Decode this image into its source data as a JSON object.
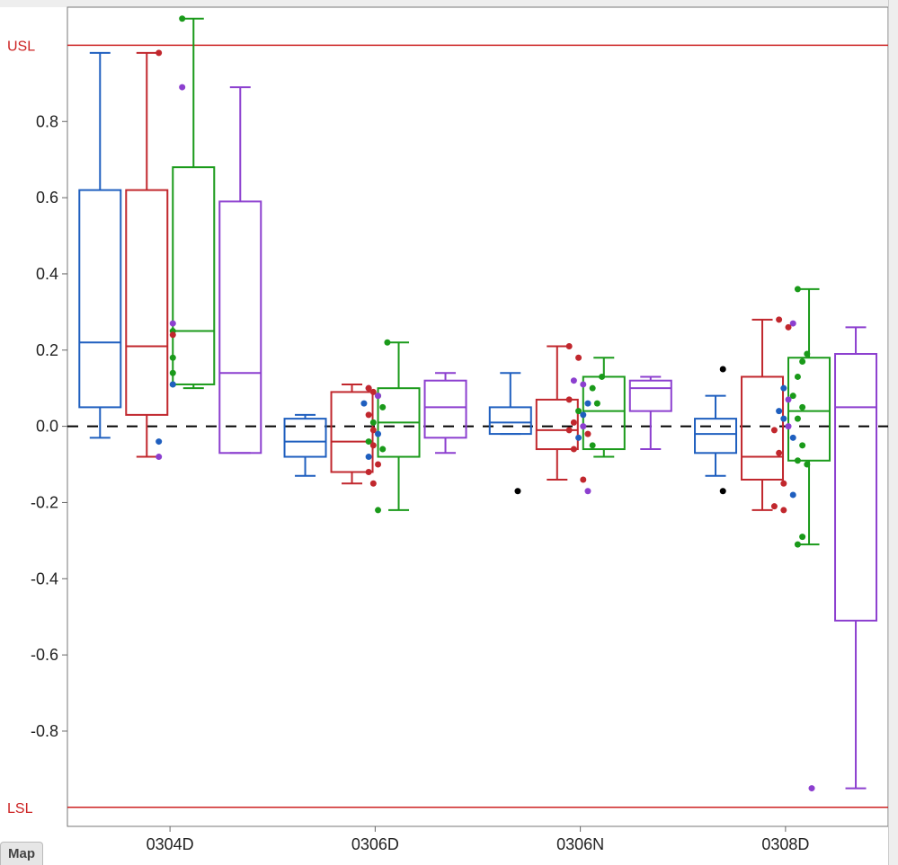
{
  "ui": {
    "mapTab": "Map"
  },
  "chart_data": {
    "type": "boxplot",
    "title": "",
    "xlabel": "",
    "ylabel": "",
    "ylim": [
      -1.05,
      1.1
    ],
    "x_categories": [
      "0304D",
      "0306D",
      "0306N",
      "0308D"
    ],
    "usl": {
      "label": "USL",
      "value": 1.0
    },
    "lsl": {
      "label": "LSL",
      "value": -1.0
    },
    "refline": 0.0,
    "grid": false,
    "series_colors": {
      "s1": "#1f5fbf",
      "s2": "#c1272d",
      "s3": "#1a9a1a",
      "s4": "#8c3fcf",
      "outlier": "#000"
    },
    "boxes": [
      {
        "cat": "0304D",
        "series": "s1",
        "min": -0.03,
        "q1": 0.05,
        "median": 0.22,
        "q3": 0.62,
        "max": 0.98
      },
      {
        "cat": "0304D",
        "series": "s2",
        "min": -0.08,
        "q1": 0.03,
        "median": 0.21,
        "q3": 0.62,
        "max": 0.98
      },
      {
        "cat": "0304D",
        "series": "s3",
        "min": 0.1,
        "q1": 0.11,
        "median": 0.25,
        "q3": 0.68,
        "max": 1.07
      },
      {
        "cat": "0304D",
        "series": "s4",
        "min": -0.07,
        "q1": -0.07,
        "median": 0.14,
        "q3": 0.59,
        "max": 0.89
      },
      {
        "cat": "0306D",
        "series": "s1",
        "min": -0.13,
        "q1": -0.08,
        "median": -0.04,
        "q3": 0.02,
        "max": 0.03
      },
      {
        "cat": "0306D",
        "series": "s2",
        "min": -0.15,
        "q1": -0.12,
        "median": -0.04,
        "q3": 0.09,
        "max": 0.11
      },
      {
        "cat": "0306D",
        "series": "s3",
        "min": -0.22,
        "q1": -0.08,
        "median": 0.01,
        "q3": 0.1,
        "max": 0.22
      },
      {
        "cat": "0306D",
        "series": "s4",
        "min": -0.07,
        "q1": -0.03,
        "median": 0.05,
        "q3": 0.12,
        "max": 0.14
      },
      {
        "cat": "0306N",
        "series": "s1",
        "min": -0.02,
        "q1": -0.02,
        "median": 0.01,
        "q3": 0.05,
        "max": 0.14
      },
      {
        "cat": "0306N",
        "series": "s2",
        "min": -0.14,
        "q1": -0.06,
        "median": -0.01,
        "q3": 0.07,
        "max": 0.21
      },
      {
        "cat": "0306N",
        "series": "s3",
        "min": -0.08,
        "q1": -0.06,
        "median": 0.04,
        "q3": 0.13,
        "max": 0.18
      },
      {
        "cat": "0306N",
        "series": "s4",
        "min": -0.06,
        "q1": 0.04,
        "median": 0.1,
        "q3": 0.12,
        "max": 0.13
      },
      {
        "cat": "0308D",
        "series": "s1",
        "min": -0.13,
        "q1": -0.07,
        "median": -0.02,
        "q3": 0.02,
        "max": 0.08
      },
      {
        "cat": "0308D",
        "series": "s2",
        "min": -0.22,
        "q1": -0.14,
        "median": -0.08,
        "q3": 0.13,
        "max": 0.28
      },
      {
        "cat": "0308D",
        "series": "s3",
        "min": -0.31,
        "q1": -0.09,
        "median": 0.04,
        "q3": 0.18,
        "max": 0.36
      },
      {
        "cat": "0308D",
        "series": "s4",
        "min": -0.95,
        "q1": -0.51,
        "median": 0.05,
        "q3": 0.19,
        "max": 0.26
      }
    ],
    "points": [
      {
        "cat": "0304D",
        "x_jitter": 1.7,
        "y": 0.98,
        "color": "s2"
      },
      {
        "cat": "0304D",
        "x_jitter": 1.7,
        "y": -0.04,
        "color": "s1"
      },
      {
        "cat": "0304D",
        "x_jitter": 1.7,
        "y": -0.08,
        "color": "s4"
      },
      {
        "cat": "0304D",
        "x_jitter": 2.2,
        "y": 1.07,
        "color": "s3"
      },
      {
        "cat": "0304D",
        "x_jitter": 2.2,
        "y": 0.89,
        "color": "s4"
      },
      {
        "cat": "0304D",
        "x_jitter": 2.0,
        "y": 0.27,
        "color": "s4"
      },
      {
        "cat": "0304D",
        "x_jitter": 2.0,
        "y": 0.25,
        "color": "s3"
      },
      {
        "cat": "0304D",
        "x_jitter": 2.0,
        "y": 0.24,
        "color": "s2"
      },
      {
        "cat": "0304D",
        "x_jitter": 2.0,
        "y": 0.18,
        "color": "s3"
      },
      {
        "cat": "0304D",
        "x_jitter": 2.0,
        "y": 0.14,
        "color": "s3"
      },
      {
        "cat": "0304D",
        "x_jitter": 2.0,
        "y": 0.11,
        "color": "s3"
      },
      {
        "cat": "0304D",
        "x_jitter": 2.0,
        "y": 0.11,
        "color": "s1"
      },
      {
        "cat": "0306D",
        "x_jitter": 1.8,
        "y": 0.1,
        "color": "s4"
      },
      {
        "cat": "0306D",
        "x_jitter": 1.8,
        "y": 0.1,
        "color": "s2"
      },
      {
        "cat": "0306D",
        "x_jitter": 1.9,
        "y": 0.09,
        "color": "s2"
      },
      {
        "cat": "0306D",
        "x_jitter": 2.0,
        "y": 0.08,
        "color": "s3"
      },
      {
        "cat": "0306D",
        "x_jitter": 2.0,
        "y": 0.08,
        "color": "s4"
      },
      {
        "cat": "0306D",
        "x_jitter": 1.7,
        "y": 0.06,
        "color": "s1"
      },
      {
        "cat": "0306D",
        "x_jitter": 2.1,
        "y": 0.05,
        "color": "s3"
      },
      {
        "cat": "0306D",
        "x_jitter": 1.8,
        "y": 0.03,
        "color": "s2"
      },
      {
        "cat": "0306D",
        "x_jitter": 2.2,
        "y": 0.22,
        "color": "s3"
      },
      {
        "cat": "0306D",
        "x_jitter": 1.9,
        "y": 0.01,
        "color": "s3"
      },
      {
        "cat": "0306D",
        "x_jitter": 1.9,
        "y": -0.01,
        "color": "s2"
      },
      {
        "cat": "0306D",
        "x_jitter": 2.0,
        "y": -0.02,
        "color": "s1"
      },
      {
        "cat": "0306D",
        "x_jitter": 1.8,
        "y": -0.04,
        "color": "s3"
      },
      {
        "cat": "0306D",
        "x_jitter": 1.9,
        "y": -0.05,
        "color": "s2"
      },
      {
        "cat": "0306D",
        "x_jitter": 2.1,
        "y": -0.06,
        "color": "s3"
      },
      {
        "cat": "0306D",
        "x_jitter": 1.8,
        "y": -0.08,
        "color": "s1"
      },
      {
        "cat": "0306D",
        "x_jitter": 2.0,
        "y": -0.1,
        "color": "s2"
      },
      {
        "cat": "0306D",
        "x_jitter": 1.8,
        "y": -0.12,
        "color": "s2"
      },
      {
        "cat": "0306D",
        "x_jitter": 1.9,
        "y": -0.15,
        "color": "s2"
      },
      {
        "cat": "0306D",
        "x_jitter": 2.0,
        "y": -0.22,
        "color": "s3"
      },
      {
        "cat": "0306N",
        "x_jitter": 0.6,
        "y": -0.17,
        "color": "outlier"
      },
      {
        "cat": "0306N",
        "x_jitter": 1.7,
        "y": 0.21,
        "color": "s2"
      },
      {
        "cat": "0306N",
        "x_jitter": 1.9,
        "y": 0.18,
        "color": "s2"
      },
      {
        "cat": "0306N",
        "x_jitter": 2.4,
        "y": 0.13,
        "color": "s3"
      },
      {
        "cat": "0306N",
        "x_jitter": 1.8,
        "y": 0.12,
        "color": "s4"
      },
      {
        "cat": "0306N",
        "x_jitter": 2.0,
        "y": 0.11,
        "color": "s4"
      },
      {
        "cat": "0306N",
        "x_jitter": 2.2,
        "y": 0.1,
        "color": "s3"
      },
      {
        "cat": "0306N",
        "x_jitter": 1.7,
        "y": 0.07,
        "color": "s2"
      },
      {
        "cat": "0306N",
        "x_jitter": 2.1,
        "y": 0.06,
        "color": "s1"
      },
      {
        "cat": "0306N",
        "x_jitter": 2.3,
        "y": 0.06,
        "color": "s3"
      },
      {
        "cat": "0306N",
        "x_jitter": 1.9,
        "y": 0.04,
        "color": "s3"
      },
      {
        "cat": "0306N",
        "x_jitter": 2.0,
        "y": 0.03,
        "color": "s1"
      },
      {
        "cat": "0306N",
        "x_jitter": 1.8,
        "y": 0.01,
        "color": "s2"
      },
      {
        "cat": "0306N",
        "x_jitter": 2.0,
        "y": 0.0,
        "color": "s4"
      },
      {
        "cat": "0306N",
        "x_jitter": 1.7,
        "y": -0.01,
        "color": "s2"
      },
      {
        "cat": "0306N",
        "x_jitter": 2.1,
        "y": -0.02,
        "color": "s2"
      },
      {
        "cat": "0306N",
        "x_jitter": 1.9,
        "y": -0.03,
        "color": "s1"
      },
      {
        "cat": "0306N",
        "x_jitter": 2.2,
        "y": -0.05,
        "color": "s3"
      },
      {
        "cat": "0306N",
        "x_jitter": 1.8,
        "y": -0.06,
        "color": "s2"
      },
      {
        "cat": "0306N",
        "x_jitter": 2.0,
        "y": -0.14,
        "color": "s2"
      },
      {
        "cat": "0306N",
        "x_jitter": 2.1,
        "y": -0.17,
        "color": "s4"
      },
      {
        "cat": "0308D",
        "x_jitter": 0.6,
        "y": 0.15,
        "color": "outlier"
      },
      {
        "cat": "0308D",
        "x_jitter": 0.6,
        "y": -0.17,
        "color": "outlier"
      },
      {
        "cat": "0308D",
        "x_jitter": 2.2,
        "y": 0.36,
        "color": "s3"
      },
      {
        "cat": "0308D",
        "x_jitter": 1.8,
        "y": 0.28,
        "color": "s2"
      },
      {
        "cat": "0308D",
        "x_jitter": 2.1,
        "y": 0.27,
        "color": "s4"
      },
      {
        "cat": "0308D",
        "x_jitter": 2.0,
        "y": 0.26,
        "color": "s2"
      },
      {
        "cat": "0308D",
        "x_jitter": 2.4,
        "y": 0.19,
        "color": "s3"
      },
      {
        "cat": "0308D",
        "x_jitter": 2.3,
        "y": 0.17,
        "color": "s3"
      },
      {
        "cat": "0308D",
        "x_jitter": 2.2,
        "y": 0.13,
        "color": "s3"
      },
      {
        "cat": "0308D",
        "x_jitter": 1.9,
        "y": 0.1,
        "color": "s1"
      },
      {
        "cat": "0308D",
        "x_jitter": 2.1,
        "y": 0.08,
        "color": "s3"
      },
      {
        "cat": "0308D",
        "x_jitter": 2.0,
        "y": 0.07,
        "color": "s4"
      },
      {
        "cat": "0308D",
        "x_jitter": 2.3,
        "y": 0.05,
        "color": "s3"
      },
      {
        "cat": "0308D",
        "x_jitter": 1.8,
        "y": 0.04,
        "color": "s1"
      },
      {
        "cat": "0308D",
        "x_jitter": 1.9,
        "y": 0.02,
        "color": "s1"
      },
      {
        "cat": "0308D",
        "x_jitter": 2.2,
        "y": 0.02,
        "color": "s3"
      },
      {
        "cat": "0308D",
        "x_jitter": 2.0,
        "y": 0.0,
        "color": "s4"
      },
      {
        "cat": "0308D",
        "x_jitter": 1.7,
        "y": -0.01,
        "color": "s2"
      },
      {
        "cat": "0308D",
        "x_jitter": 2.1,
        "y": -0.03,
        "color": "s1"
      },
      {
        "cat": "0308D",
        "x_jitter": 2.3,
        "y": -0.05,
        "color": "s3"
      },
      {
        "cat": "0308D",
        "x_jitter": 1.8,
        "y": -0.07,
        "color": "s2"
      },
      {
        "cat": "0308D",
        "x_jitter": 2.2,
        "y": -0.09,
        "color": "s3"
      },
      {
        "cat": "0308D",
        "x_jitter": 2.4,
        "y": -0.1,
        "color": "s3"
      },
      {
        "cat": "0308D",
        "x_jitter": 1.9,
        "y": -0.15,
        "color": "s2"
      },
      {
        "cat": "0308D",
        "x_jitter": 2.1,
        "y": -0.18,
        "color": "s1"
      },
      {
        "cat": "0308D",
        "x_jitter": 1.7,
        "y": -0.21,
        "color": "s2"
      },
      {
        "cat": "0308D",
        "x_jitter": 1.9,
        "y": -0.22,
        "color": "s2"
      },
      {
        "cat": "0308D",
        "x_jitter": 2.3,
        "y": -0.29,
        "color": "s3"
      },
      {
        "cat": "0308D",
        "x_jitter": 2.2,
        "y": -0.31,
        "color": "s3"
      },
      {
        "cat": "0308D",
        "x_jitter": 2.5,
        "y": -0.95,
        "color": "s4"
      }
    ],
    "yticks": [
      -0.8,
      -0.6,
      -0.4,
      -0.2,
      0.0,
      0.2,
      0.4,
      0.6,
      0.8
    ]
  }
}
